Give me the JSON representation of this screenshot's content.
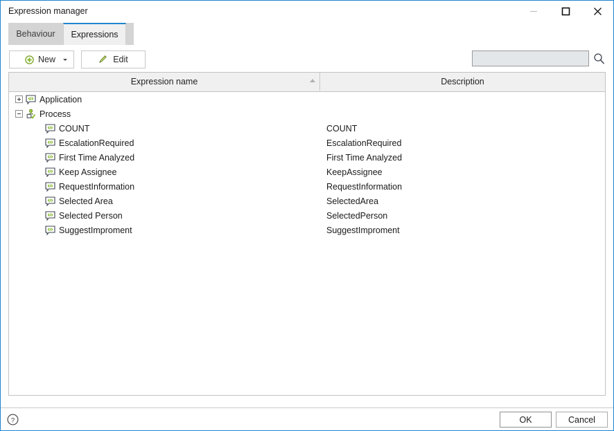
{
  "window": {
    "title": "Expression manager",
    "controls": {
      "minimize": "minimize-icon",
      "maximize": "maximize-icon",
      "close": "close-icon"
    }
  },
  "tabs": [
    {
      "label": "Behaviour",
      "active": false
    },
    {
      "label": "Expressions",
      "active": true
    }
  ],
  "toolbar": {
    "new_label": "New",
    "new_icon": "plus-circle-icon",
    "new_dropdown_icon": "chevron-down-icon",
    "edit_label": "Edit",
    "edit_icon": "pencil-icon",
    "search_value": "",
    "search_placeholder": "",
    "search_icon": "search-icon"
  },
  "grid": {
    "columns": [
      {
        "label": "Expression name",
        "sort": "ascending"
      },
      {
        "label": "Description",
        "sort": "none"
      }
    ],
    "rows": [
      {
        "name": "Application",
        "description": "",
        "level": 0,
        "expander": "plus",
        "icon": "expression-icon"
      },
      {
        "name": "Process",
        "description": "",
        "level": 0,
        "expander": "minus",
        "icon": "process-icon"
      },
      {
        "name": "COUNT",
        "description": "COUNT",
        "level": 1,
        "expander": "none",
        "icon": "expression-icon"
      },
      {
        "name": "EscalationRequired",
        "description": "EscalationRequired",
        "level": 1,
        "expander": "none",
        "icon": "expression-icon"
      },
      {
        "name": "First Time Analyzed",
        "description": "First Time Analyzed",
        "level": 1,
        "expander": "none",
        "icon": "expression-icon"
      },
      {
        "name": "Keep Assignee",
        "description": "KeepAssignee",
        "level": 1,
        "expander": "none",
        "icon": "expression-icon"
      },
      {
        "name": "RequestInformation",
        "description": "RequestInformation",
        "level": 1,
        "expander": "none",
        "icon": "expression-icon"
      },
      {
        "name": "Selected Area",
        "description": "SelectedArea",
        "level": 1,
        "expander": "none",
        "icon": "expression-icon"
      },
      {
        "name": "Selected Person",
        "description": "SelectedPerson",
        "level": 1,
        "expander": "none",
        "icon": "expression-icon"
      },
      {
        "name": "SuggestImproment",
        "description": "SuggestImproment",
        "level": 1,
        "expander": "none",
        "icon": "expression-icon"
      }
    ]
  },
  "footer": {
    "help_icon": "help-circle-icon",
    "ok_label": "OK",
    "cancel_label": "Cancel"
  },
  "colors": {
    "accent": "#1e84ce",
    "tab_inactive": "#d4d4d4",
    "tab_active": "#f0f0f0",
    "header": "#f0f0f0",
    "icon_green": "#7ab317",
    "icon_blue": "#2b4f8e",
    "search_field": "#e4e7ea"
  }
}
